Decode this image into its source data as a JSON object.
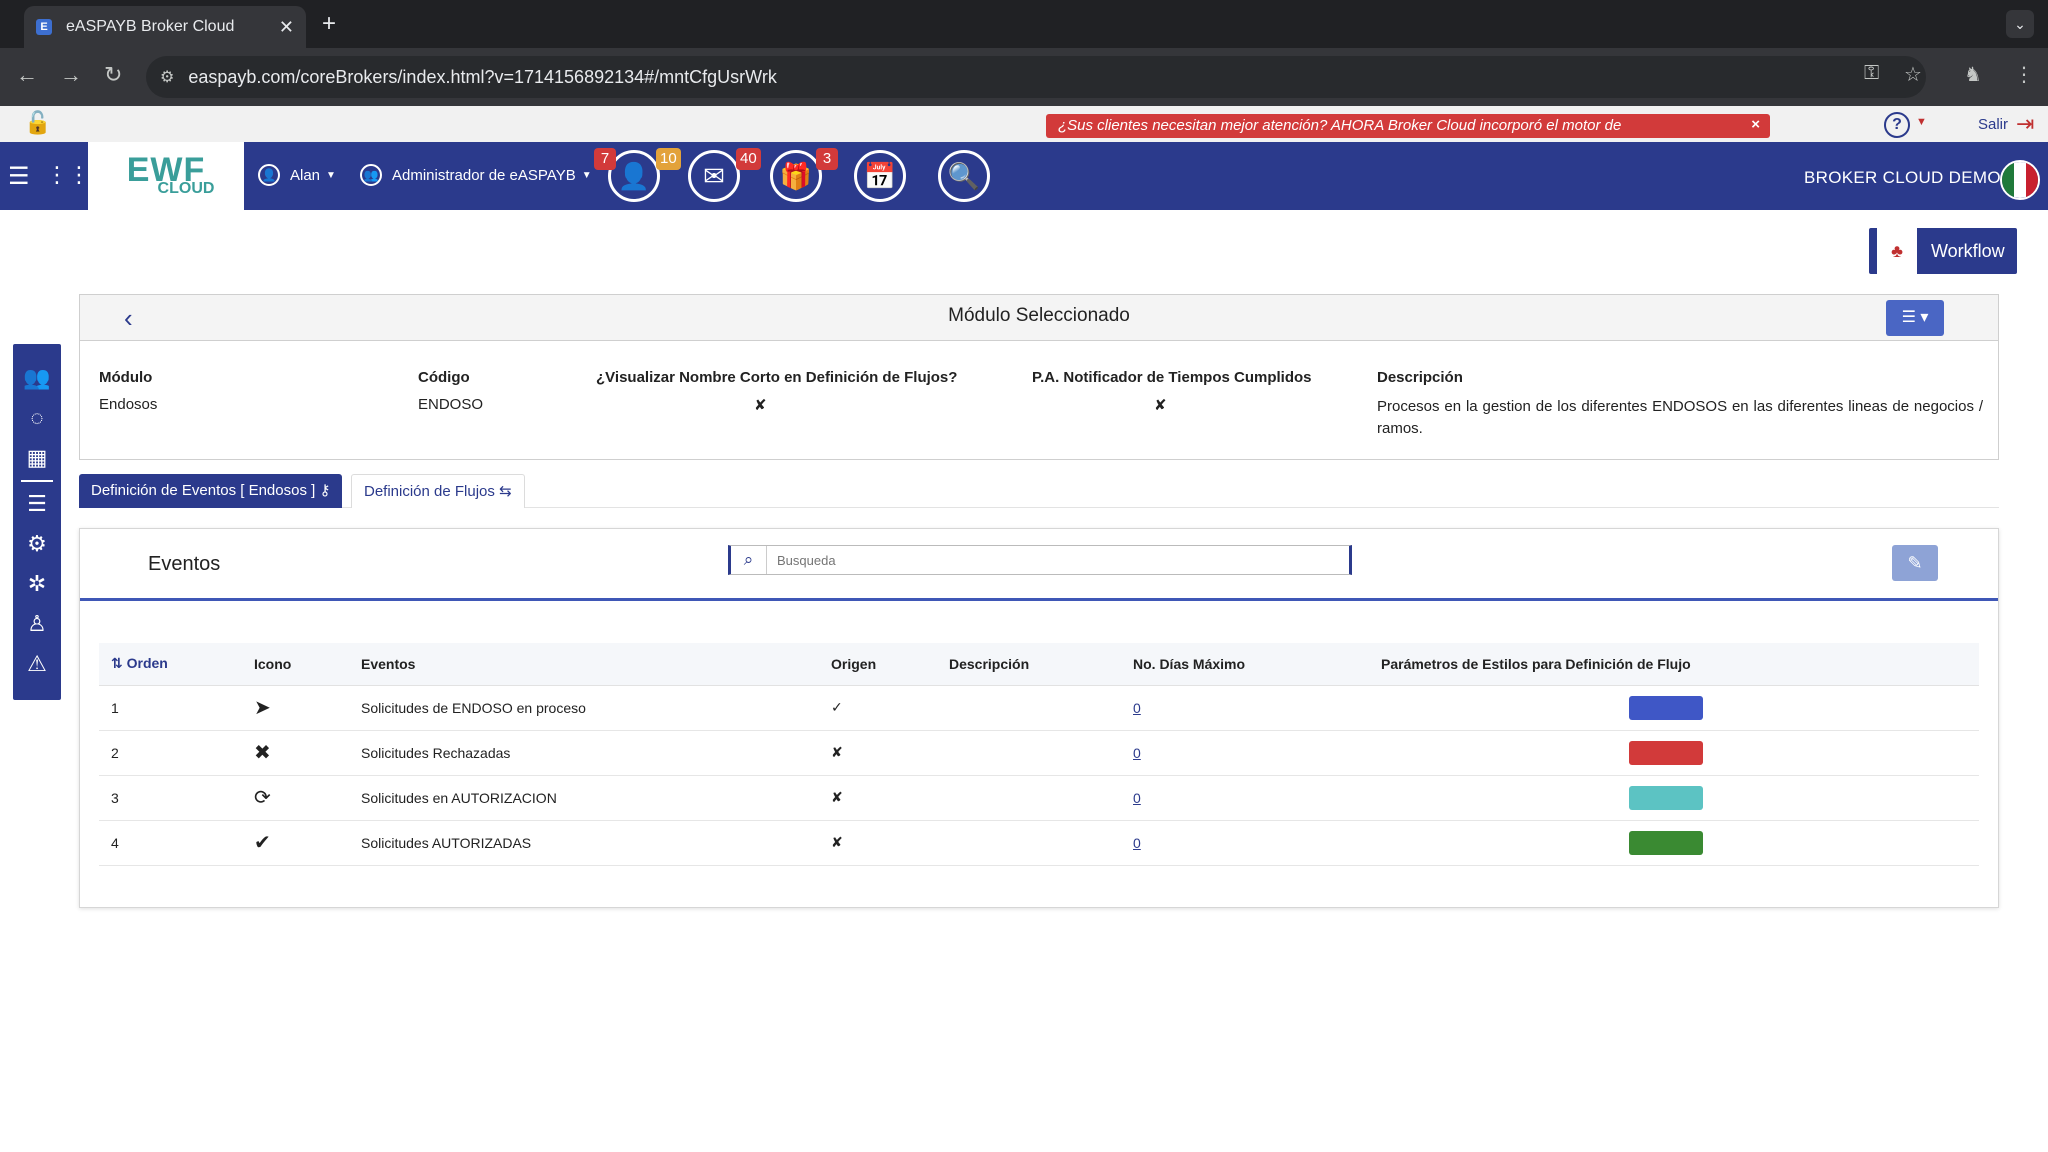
{
  "browser": {
    "tab_title": "eASPAYB Broker Cloud",
    "tab_favicon": "E",
    "url": "easpayb.com/coreBrokers/index.html?v=1714156892134#/mntCfgUsrWrk"
  },
  "notif_strip": {
    "promo_text": "¿Sus clientes necesitan mejor atención? AHORA Broker Cloud incorporó el motor de",
    "promo_close": "×",
    "help": "?",
    "salir": "Salir"
  },
  "header": {
    "logo_main": "EWF",
    "logo_sub": "CLOUD",
    "user": "Alan",
    "admin": "Administrador de eASPAYB",
    "badges": {
      "users": "7",
      "alerts": "10",
      "mail": "40",
      "gifts": "3"
    },
    "brand": "BROKER CLOUD DEMO",
    "badge_colors": {
      "red": "#d23a3a",
      "orange": "#e3a23a"
    }
  },
  "workflow_button": {
    "label": "Workflow"
  },
  "module": {
    "title": "Módulo Seleccionado",
    "labels": {
      "modulo": "Módulo",
      "codigo": "Código",
      "visualizar": "¿Visualizar Nombre Corto en Definición de Flujos?",
      "notificador": "P.A. Notificador de Tiempos Cumplidos",
      "descripcion": "Descripción"
    },
    "values": {
      "modulo": "Endosos",
      "codigo": "ENDOSO",
      "visualizar": "✘",
      "notificador": "✘",
      "descripcion": "Procesos en la gestion de los diferentes ENDOSOS en las diferentes lineas de negocios / ramos."
    }
  },
  "tabs": {
    "active": "Definición de Eventos [ Endosos ]",
    "inactive": "Definición de Flujos"
  },
  "events": {
    "title": "Eventos",
    "search_placeholder": "Busqueda",
    "columns": {
      "orden": "Orden",
      "icono": "Icono",
      "eventos": "Eventos",
      "origen": "Origen",
      "descripcion": "Descripción",
      "dias": "No. Días Máximo",
      "estilos": "Parámetros de Estilos para Definición de Flujo"
    },
    "rows": [
      {
        "orden": "1",
        "icon": "paper-plane-icon",
        "glyph": "➤",
        "evento": "Solicitudes de ENDOSO en proceso",
        "origen": "✓",
        "descripcion": "",
        "dias": "0",
        "color": "#3f57c6"
      },
      {
        "orden": "2",
        "icon": "times-icon",
        "glyph": "✖",
        "evento": "Solicitudes Rechazadas",
        "origen": "✘",
        "descripcion": "",
        "dias": "0",
        "color": "#d23a3a"
      },
      {
        "orden": "3",
        "icon": "refresh-icon",
        "glyph": "⟳",
        "evento": "Solicitudes en AUTORIZACION",
        "origen": "✘",
        "descripcion": "",
        "dias": "0",
        "color": "#5cc3c3"
      },
      {
        "orden": "4",
        "icon": "check-icon",
        "glyph": "✔",
        "evento": "Solicitudes AUTORIZADAS",
        "origen": "✘",
        "descripcion": "",
        "dias": "0",
        "color": "#3a8a32"
      }
    ]
  }
}
